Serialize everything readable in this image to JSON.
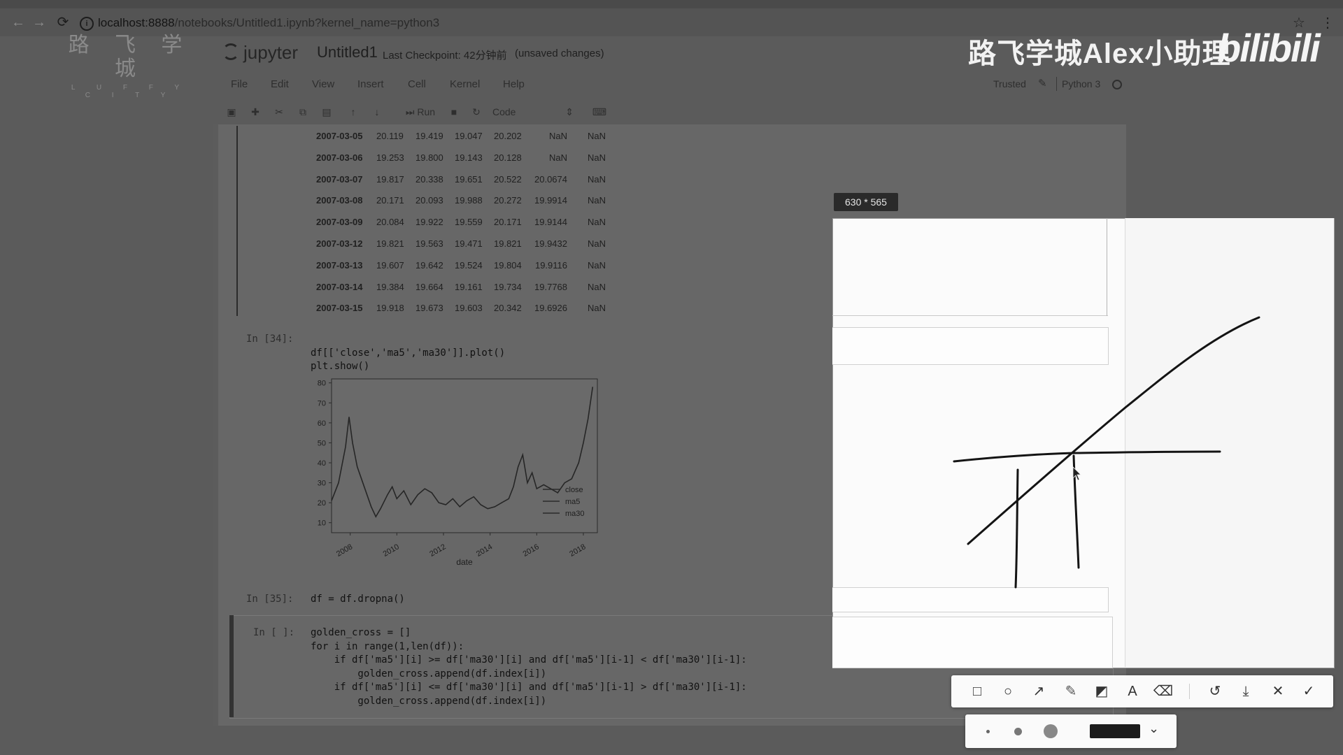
{
  "browser": {
    "url_host": "localhost:8888",
    "url_path": "/notebooks/Untitled1.ipynb?kernel_name=python3"
  },
  "watermark": {
    "luffy_zh": "路 飞 学 城",
    "luffy_en": "L U F F Y C I T Y",
    "brand": "路飞学城Alex小助理",
    "bilibili": "bilibili"
  },
  "jupyter": {
    "logo_text": "jupyter",
    "notebook_name": "Untitled1",
    "checkpoint": "Last Checkpoint: 42分钟前",
    "unsaved": "(unsaved changes)",
    "menu": [
      "File",
      "Edit",
      "View",
      "Insert",
      "Cell",
      "Kernel",
      "Help"
    ],
    "trusted": "Trusted",
    "kernel": "Python 3",
    "toolbar": {
      "run_label": "Run",
      "cell_type": "Code"
    }
  },
  "dataframe_rows": [
    [
      "2007-03-05",
      "20.119",
      "19.419",
      "19.047",
      "20.202",
      "NaN",
      "NaN"
    ],
    [
      "2007-03-06",
      "19.253",
      "19.800",
      "19.143",
      "20.128",
      "NaN",
      "NaN"
    ],
    [
      "2007-03-07",
      "19.817",
      "20.338",
      "19.651",
      "20.522",
      "20.0674",
      "NaN"
    ],
    [
      "2007-03-08",
      "20.171",
      "20.093",
      "19.988",
      "20.272",
      "19.9914",
      "NaN"
    ],
    [
      "2007-03-09",
      "20.084",
      "19.922",
      "19.559",
      "20.171",
      "19.9144",
      "NaN"
    ],
    [
      "2007-03-12",
      "19.821",
      "19.563",
      "19.471",
      "19.821",
      "19.9432",
      "NaN"
    ],
    [
      "2007-03-13",
      "19.607",
      "19.642",
      "19.524",
      "19.804",
      "19.9116",
      "NaN"
    ],
    [
      "2007-03-14",
      "19.384",
      "19.664",
      "19.161",
      "19.734",
      "19.7768",
      "NaN"
    ],
    [
      "2007-03-15",
      "19.918",
      "19.673",
      "19.603",
      "20.342",
      "19.6926",
      "NaN"
    ]
  ],
  "cells": {
    "c34_prompt": "In [34]:",
    "c34_line1": "df[['close','ma5','ma30']].plot()",
    "c34_line2": "plt.show()",
    "c35_prompt": "In [35]:",
    "c35_line1": "df = df.dropna()",
    "c36_prompt": "In [ ]:",
    "c36_lines": [
      "golden_cross = []",
      "for i in range(1,len(df)):",
      "    if df['ma5'][i] >= df['ma30'][i] and df['ma5'][i-1] < df['ma30'][i-1]:",
      "        golden_cross.append(df.index[i])",
      "    if df['ma5'][i] <= df['ma30'][i] and df['ma5'][i-1] > df['ma30'][i-1]:",
      "        golden_cross.append(df.index[i])"
    ]
  },
  "chart_data": {
    "type": "line",
    "xlabel": "date",
    "ylabel": "",
    "ylim": [
      5,
      82
    ],
    "xlim": [
      2007.2,
      2018.6
    ],
    "yticks": [
      10,
      20,
      30,
      40,
      50,
      60,
      70,
      80
    ],
    "xticks": [
      "2008",
      "2010",
      "2012",
      "2014",
      "2016",
      "2018"
    ],
    "legend": [
      "close",
      "ma5",
      "ma30"
    ],
    "legend_position": "lower right",
    "series": [
      {
        "name": "close",
        "x": [
          2007.2,
          2007.5,
          2007.8,
          2007.95,
          2008.1,
          2008.3,
          2008.6,
          2008.9,
          2009.1,
          2009.3,
          2009.6,
          2009.8,
          2010.0,
          2010.3,
          2010.6,
          2010.9,
          2011.2,
          2011.5,
          2011.8,
          2012.1,
          2012.4,
          2012.7,
          2013.0,
          2013.3,
          2013.6,
          2013.9,
          2014.2,
          2014.5,
          2014.8,
          2015.0,
          2015.2,
          2015.4,
          2015.6,
          2015.8,
          2016.0,
          2016.3,
          2016.6,
          2016.9,
          2017.2,
          2017.5,
          2017.8,
          2018.0,
          2018.2,
          2018.4
        ],
        "y": [
          21,
          30,
          48,
          63,
          50,
          38,
          28,
          18,
          13,
          17,
          24,
          28,
          22,
          26,
          19,
          24,
          27,
          25,
          20,
          19,
          22,
          18,
          21,
          23,
          19,
          17,
          18,
          20,
          22,
          28,
          38,
          44,
          30,
          35,
          27,
          29,
          27,
          25,
          30,
          32,
          40,
          50,
          62,
          78
        ]
      }
    ]
  },
  "screenshot_tool": {
    "size_label": "630 * 565"
  }
}
